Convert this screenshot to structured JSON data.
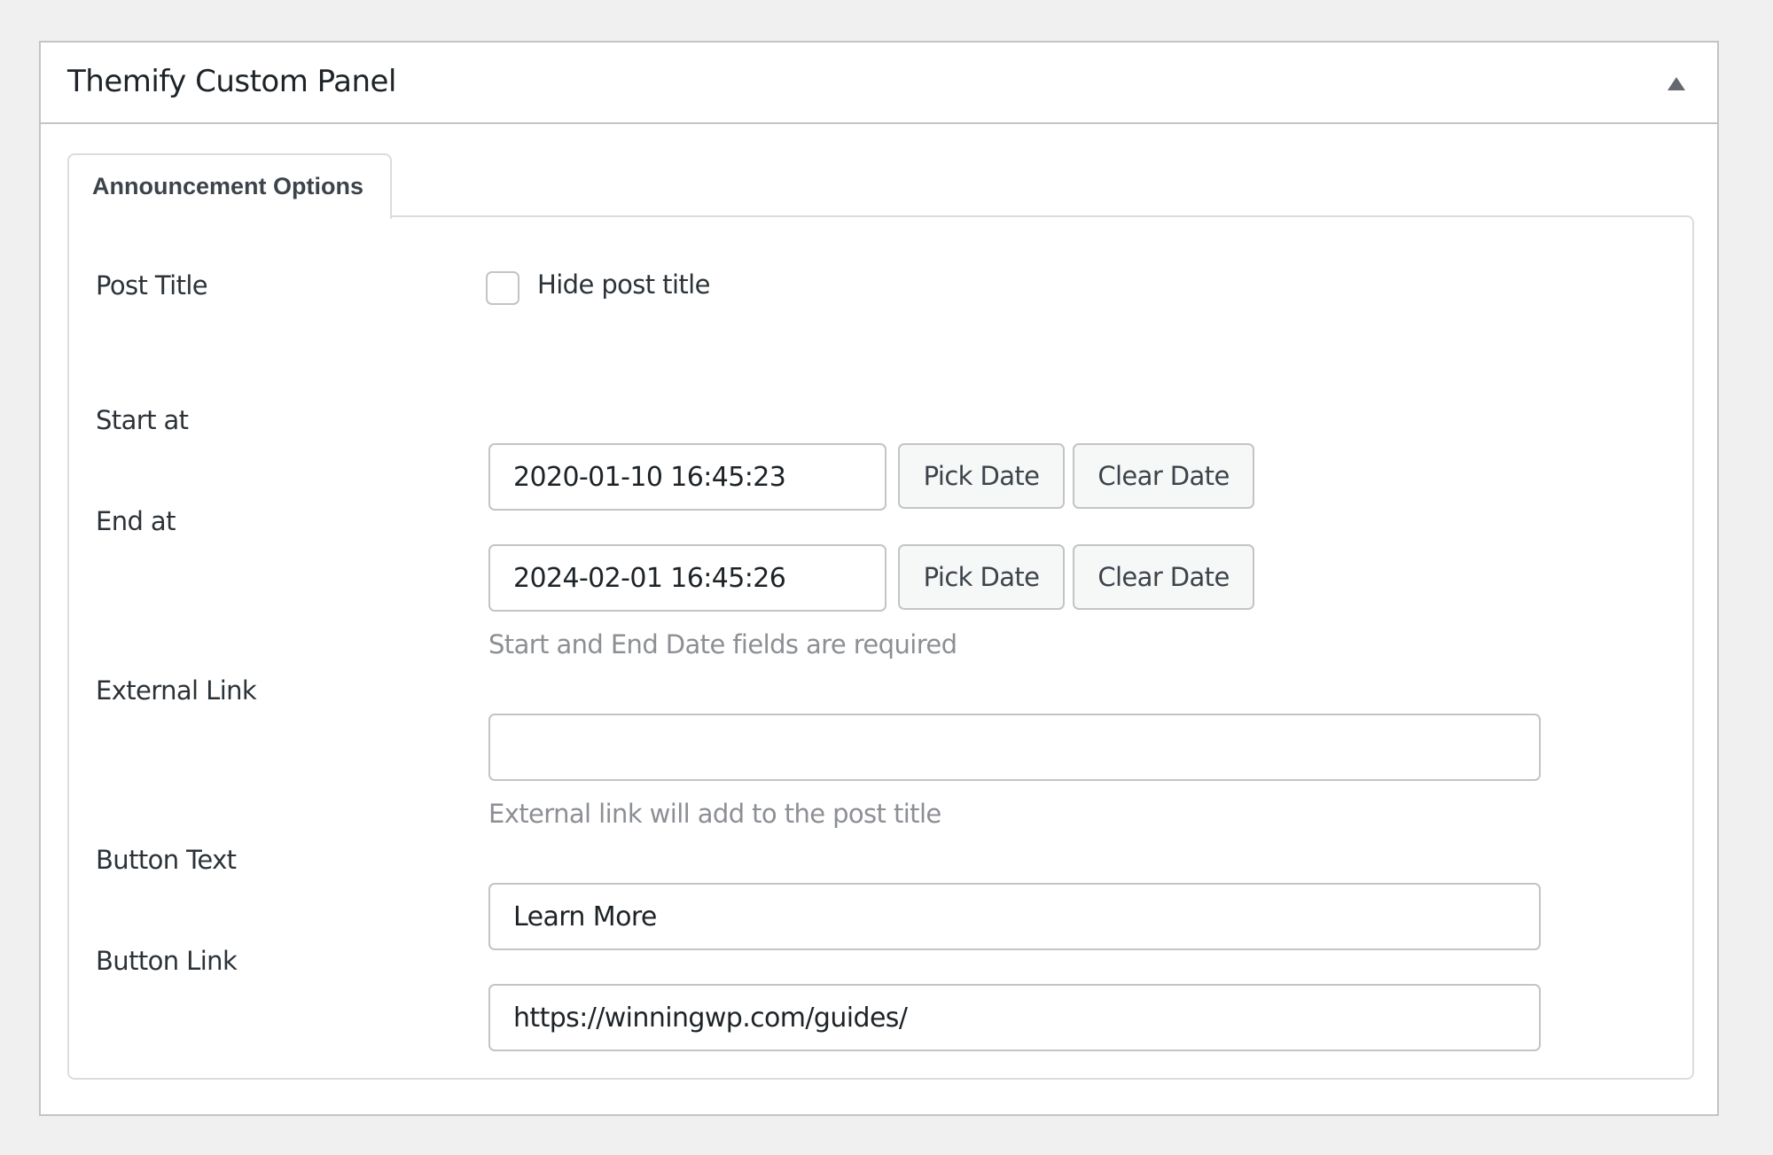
{
  "panel": {
    "title": "Themify Custom Panel",
    "toggle_icon": "triangle-up-icon"
  },
  "tabs": [
    {
      "label": "Announcement Options",
      "active": true
    }
  ],
  "fields": {
    "post_title": {
      "label": "Post Title",
      "checkbox_label": "Hide post title",
      "checked": false
    },
    "start_at": {
      "label": "Start at",
      "value": "2020-01-10 16:45:23",
      "pick_label": "Pick Date",
      "clear_label": "Clear Date"
    },
    "end_at": {
      "label": "End at",
      "value": "2024-02-01 16:45:26",
      "pick_label": "Pick Date",
      "clear_label": "Clear Date",
      "help": "Start and End Date fields are required"
    },
    "external_link": {
      "label": "External Link",
      "value": "",
      "help": "External link will add to the post title"
    },
    "button_text": {
      "label": "Button Text",
      "value": "Learn More"
    },
    "button_link": {
      "label": "Button Link",
      "value": "https://winningwp.com/guides/"
    }
  },
  "colors": {
    "page_bg": "#f0f0f1",
    "panel_border": "#c3c4c7",
    "help_text": "#8c8f94",
    "button_bg": "#f6f7f7"
  }
}
